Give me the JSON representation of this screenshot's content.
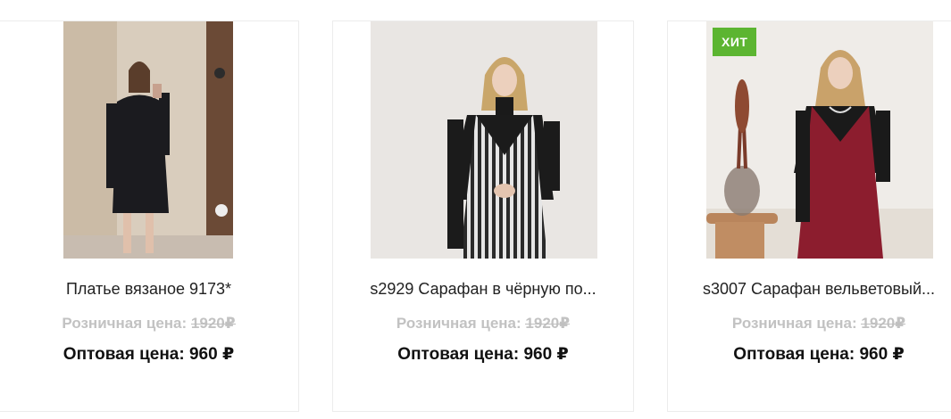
{
  "products": [
    {
      "title": "Платье вязаное 9173*",
      "retail_label": "Розничная цена:",
      "retail_price": "1920",
      "wholesale_label": "Оптовая цена:",
      "wholesale_price": "960",
      "currency": "₽",
      "badge": ""
    },
    {
      "title": "s2929 Сарафан в чёрную по...",
      "retail_label": "Розничная цена:",
      "retail_price": "1920",
      "wholesale_label": "Оптовая цена:",
      "wholesale_price": "960",
      "currency": "₽",
      "badge": ""
    },
    {
      "title": "s3007 Сарафан вельветовый...",
      "retail_label": "Розничная цена:",
      "retail_price": "1920",
      "wholesale_label": "Оптовая цена:",
      "wholesale_price": "960",
      "currency": "₽",
      "badge": "ХИТ"
    }
  ],
  "colors": {
    "badge_bg": "#5cb531",
    "retail_text": "#c2c2c2",
    "wholesale_text": "#111111"
  }
}
